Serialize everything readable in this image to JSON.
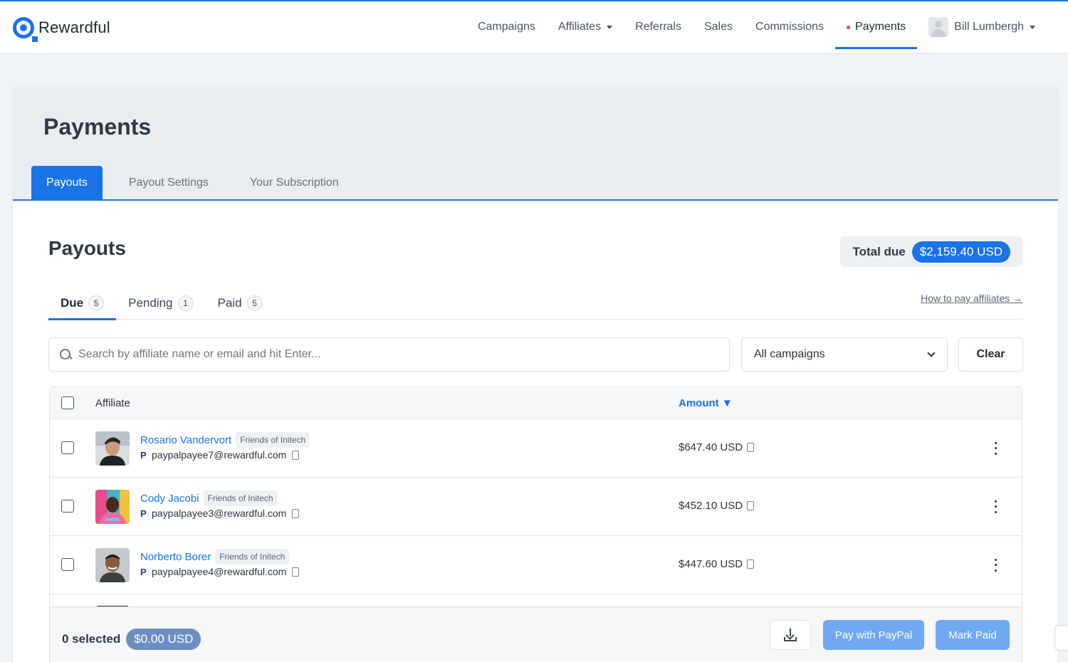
{
  "brand": {
    "name": "Rewardful",
    "accent": "#1a73e8"
  },
  "nav": {
    "items": [
      {
        "label": "Campaigns",
        "has_caret": false
      },
      {
        "label": "Affiliates",
        "has_caret": true
      },
      {
        "label": "Referrals",
        "has_caret": false
      },
      {
        "label": "Sales",
        "has_caret": false
      },
      {
        "label": "Commissions",
        "has_caret": false
      },
      {
        "label": "Payments",
        "active": true,
        "dot": true
      }
    ],
    "user": {
      "name": "Bill Lumbergh",
      "icon": "user-avatar-icon"
    }
  },
  "page": {
    "title": "Payments",
    "tabs": [
      "Payouts",
      "Payout Settings",
      "Your Subscription"
    ],
    "active_tab": "Payouts"
  },
  "payouts": {
    "title": "Payouts",
    "total_due_label": "Total due",
    "total_due_value": "$2,159.40 USD",
    "subtabs": [
      {
        "label": "Due",
        "count": "5",
        "active": true
      },
      {
        "label": "Pending",
        "count": "1"
      },
      {
        "label": "Paid",
        "count": "5"
      }
    ],
    "how_to_link": "How to pay affiliates →",
    "search": {
      "placeholder": "Search by affiliate name or email and hit Enter..."
    },
    "campaign_filter": {
      "selected": "All campaigns"
    },
    "clear_label": "Clear",
    "table": {
      "headers": {
        "affiliate": "Affiliate",
        "amount": "Amount ▼"
      },
      "rows": [
        {
          "name": "Rosario Vandervort",
          "campaign": "Friends of Initech",
          "email": "paypalpayee7@rewardful.com",
          "amount": "$647.40 USD"
        },
        {
          "name": "Cody Jacobi",
          "campaign": "Friends of Initech",
          "email": "paypalpayee3@rewardful.com",
          "amount": "$452.10 USD"
        },
        {
          "name": "Norberto Borer",
          "campaign": "Friends of Initech",
          "email": "paypalpayee4@rewardful.com",
          "amount": "$447.60 USD"
        }
      ]
    },
    "footer": {
      "selected_label": "0 selected",
      "selected_amount": "$0.00 USD",
      "pay_paypal_label": "Pay with PayPal",
      "mark_paid_label": "Mark Paid"
    }
  }
}
